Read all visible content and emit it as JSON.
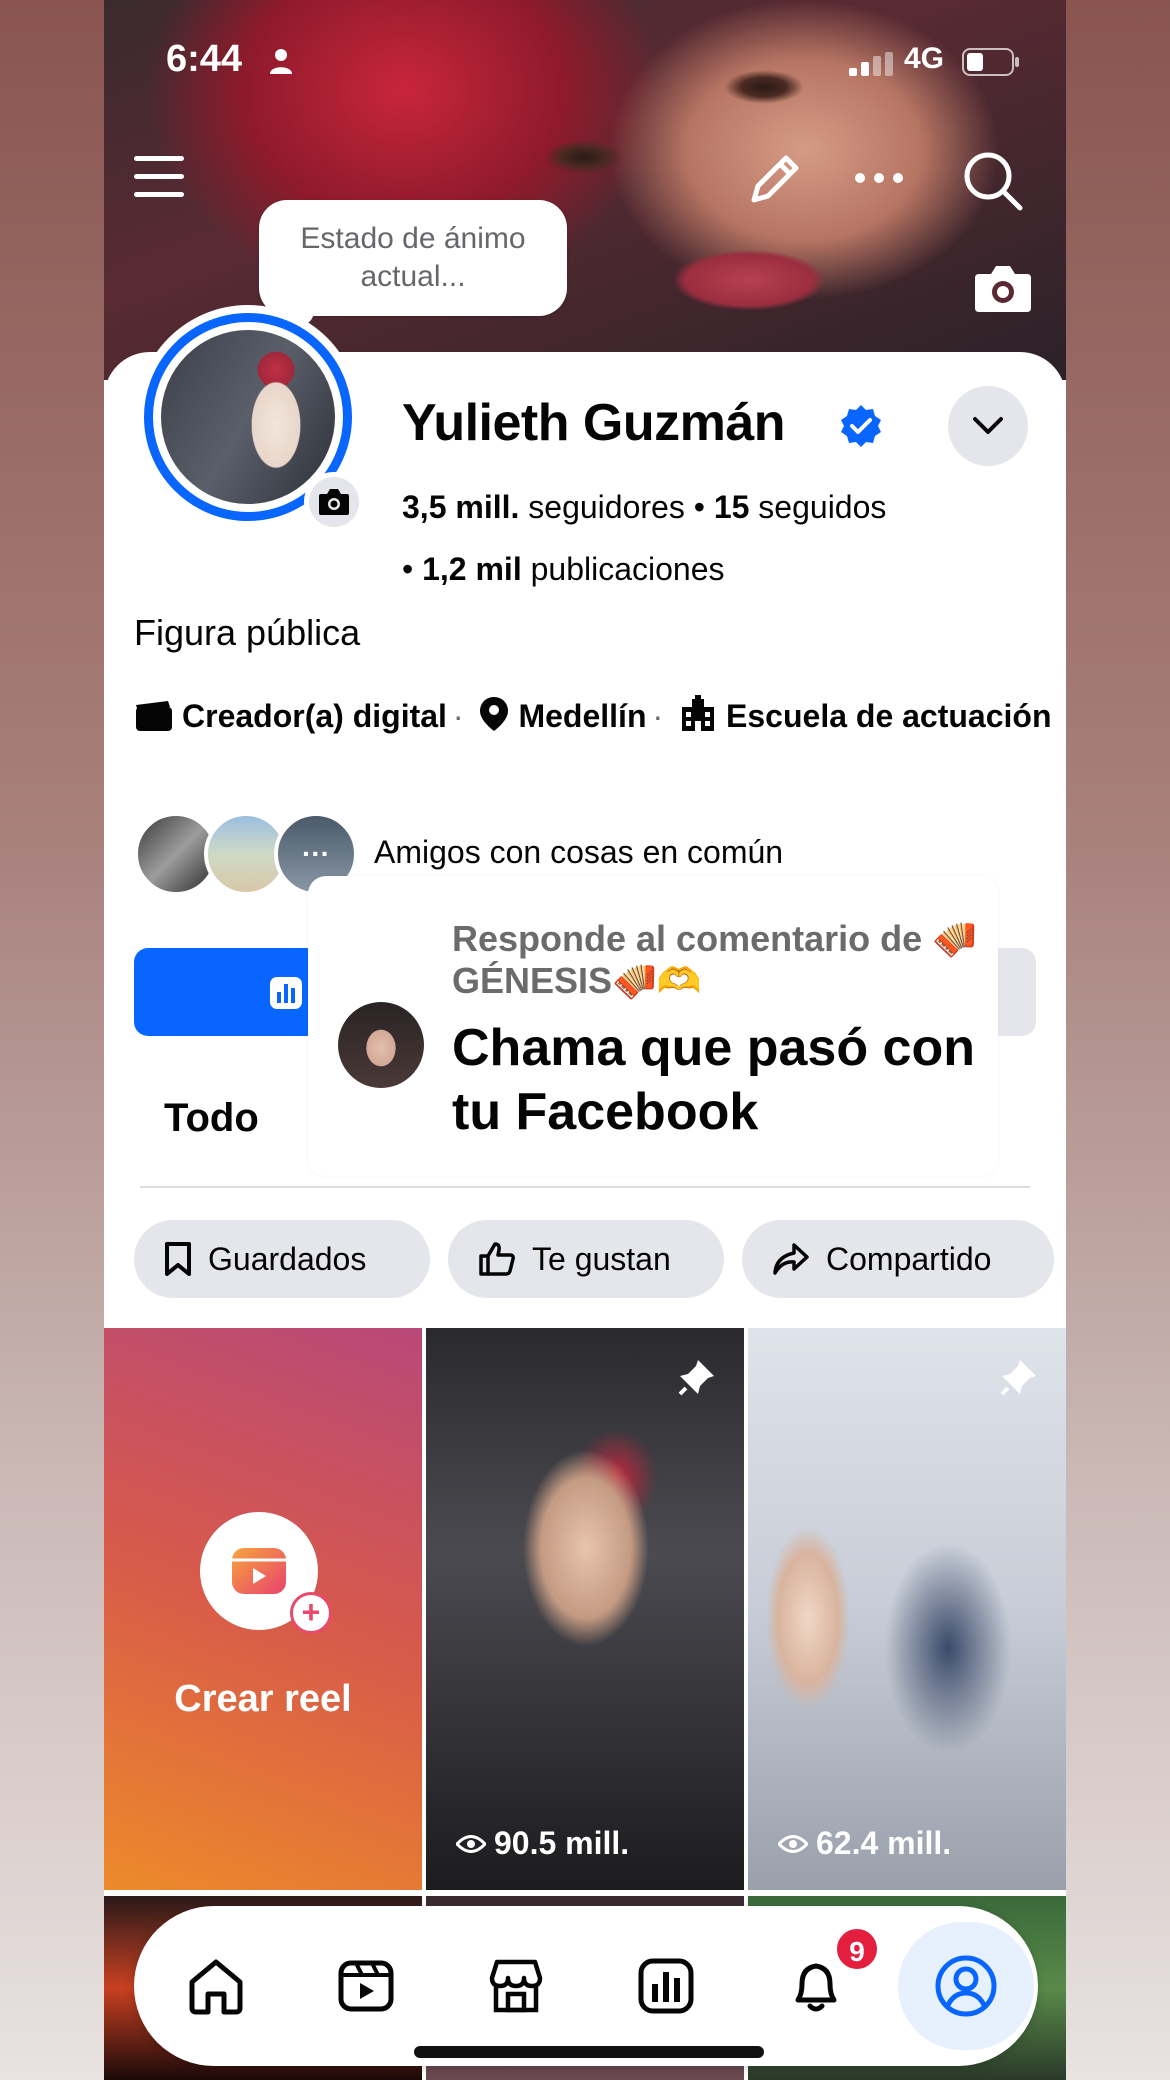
{
  "status_bar": {
    "time": "6:44",
    "network": "4G"
  },
  "mood_prompt": "Estado de ánimo actual...",
  "profile": {
    "name": "Yulieth Guzmán",
    "followers_count": "3,5 mill.",
    "followers_label": "seguidores",
    "following_count": "15",
    "following_label": "seguidos",
    "posts_count": "1,2 mil",
    "posts_label": "publicaciones",
    "category": "Figura pública",
    "detail_creator": "Creador(a) digital",
    "detail_city": "Medellín",
    "detail_school": "Escuela de actuación",
    "friends_label": "Amigos con cosas en común",
    "friends_more": "···"
  },
  "tabs": {
    "all": "Todo"
  },
  "comment_overlay": {
    "reply_to": "Responde al comentario de 🪗GÉNESIS🪗🫶",
    "text": "Chama que pasó con tu Facebook"
  },
  "filters": {
    "saved": "Guardados",
    "likes": "Te gustan",
    "shared": "Compartido"
  },
  "reels": {
    "create_label": "Crear reel",
    "create_plus": "+",
    "items": [
      {
        "views": "90.5 mill."
      },
      {
        "views": "62.4 mill."
      }
    ]
  },
  "nav": {
    "notifications_badge": "9"
  },
  "colors": {
    "accent": "#0866ff",
    "chip_bg": "#e4e6eb",
    "badge": "#e41e3f"
  }
}
